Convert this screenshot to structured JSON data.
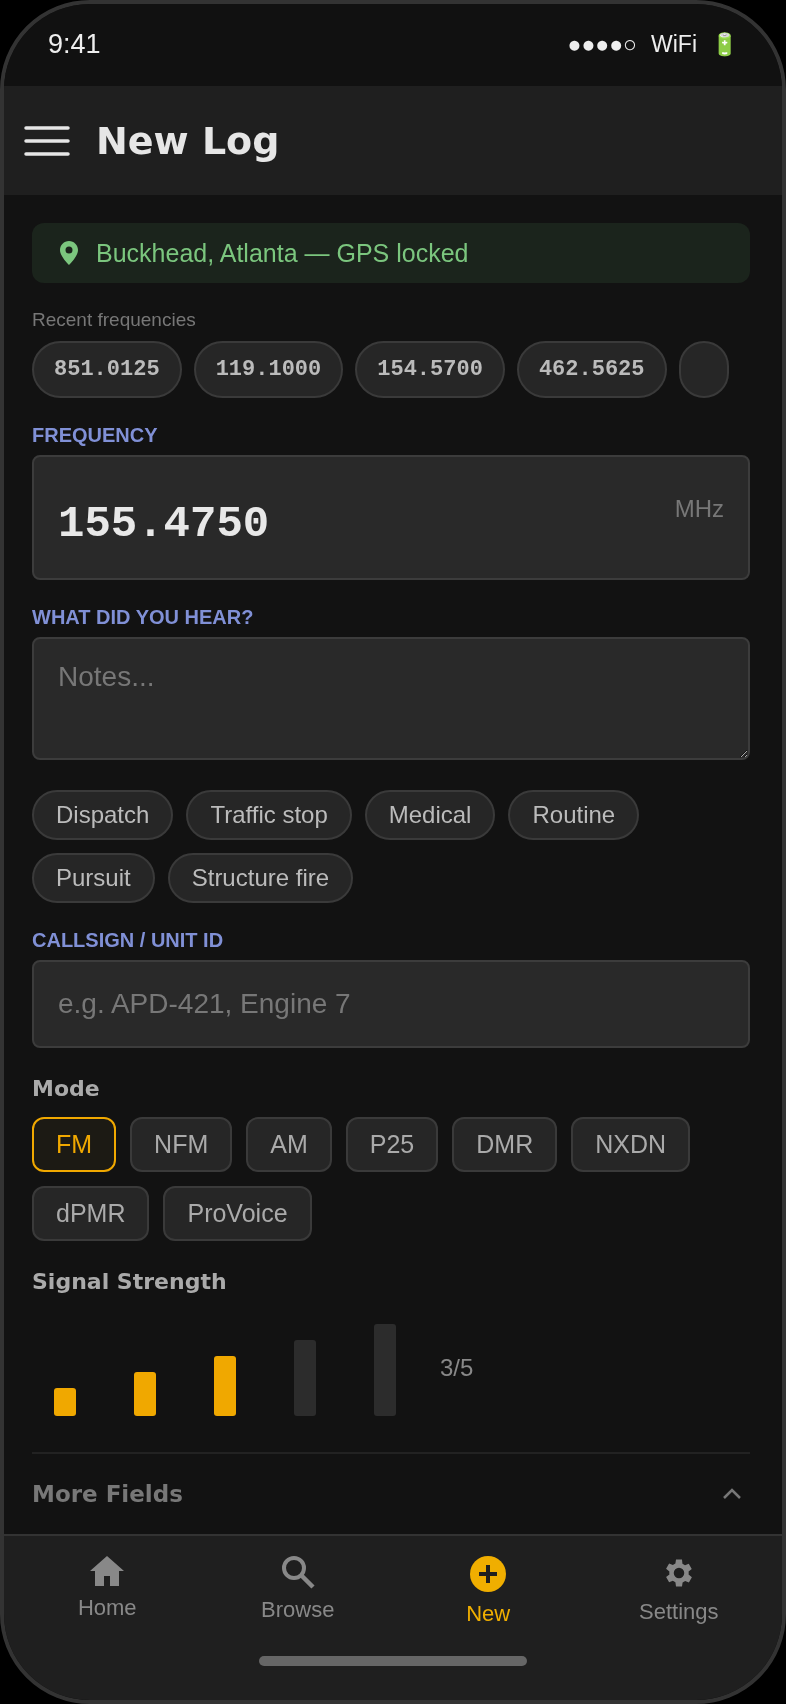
{
  "status_bar": {
    "time": "9:41",
    "signal": "●●●●○",
    "network": "WiFi",
    "battery": "🔋"
  },
  "header": {
    "title": "New Log"
  },
  "location": {
    "text": "Buckhead, Atlanta — GPS locked"
  },
  "recent": {
    "label": "Recent frequencies",
    "chips": [
      "851.0125",
      "119.1000",
      "154.5700",
      "462.5625"
    ]
  },
  "frequency": {
    "label": "FREQUENCY",
    "value": "155.4750",
    "unit": "MHz"
  },
  "notes": {
    "label": "WHAT DID YOU HEAR?",
    "placeholder": "Notes..."
  },
  "tags": [
    {
      "label": "Dispatch",
      "selected": false
    },
    {
      "label": "Traffic stop",
      "selected": false
    },
    {
      "label": "Medical",
      "selected": false
    },
    {
      "label": "Routine",
      "selected": false
    },
    {
      "label": "Pursuit",
      "selected": false
    },
    {
      "label": "Structure fire",
      "selected": false
    }
  ],
  "callsign": {
    "label": "CALLSIGN / UNIT ID",
    "placeholder": "e.g. APD-421, Engine 7"
  },
  "mode": {
    "label": "Mode",
    "options": [
      {
        "label": "FM",
        "selected": true
      },
      {
        "label": "NFM",
        "selected": false
      },
      {
        "label": "AM",
        "selected": false
      },
      {
        "label": "P25",
        "selected": false
      },
      {
        "label": "DMR",
        "selected": false
      },
      {
        "label": "NXDN",
        "selected": false
      },
      {
        "label": "dPMR",
        "selected": false
      },
      {
        "label": "ProVoice",
        "selected": false
      }
    ]
  },
  "signal": {
    "label": "Signal Strength",
    "bars": [
      {
        "on": true
      },
      {
        "on": true
      },
      {
        "on": true
      },
      {
        "on": false
      },
      {
        "on": false
      }
    ],
    "reading": "3/5"
  },
  "more_fields": {
    "label": "More Fields",
    "expanded": true
  },
  "nav": [
    {
      "label": "Home",
      "kind": "home",
      "selected": false
    },
    {
      "label": "Browse",
      "kind": "search",
      "selected": false
    },
    {
      "label": "New",
      "kind": "add",
      "selected": true
    },
    {
      "label": "Settings",
      "kind": "settings",
      "selected": false
    }
  ]
}
